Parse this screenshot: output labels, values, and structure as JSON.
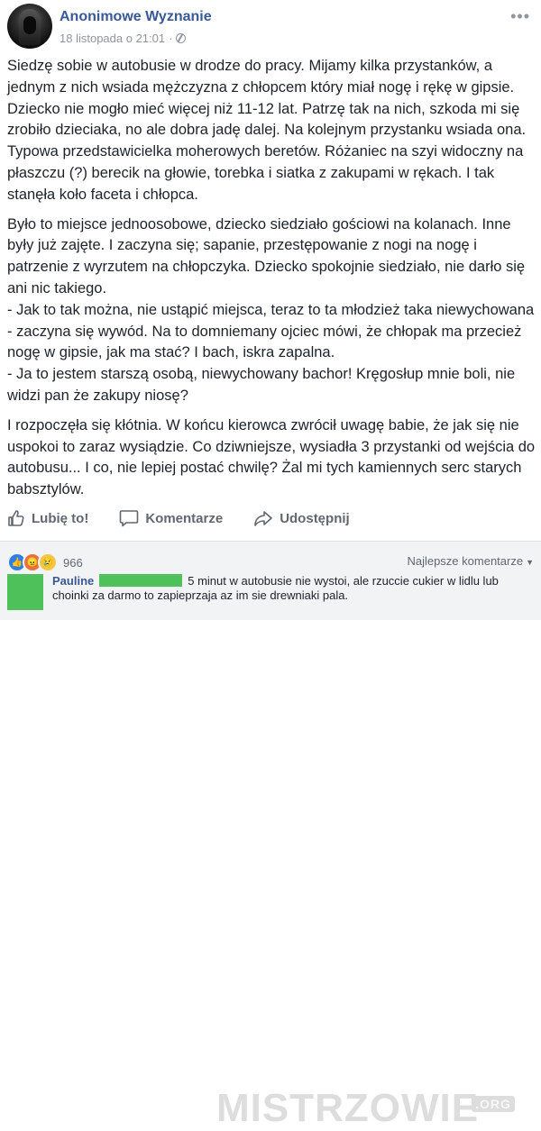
{
  "post": {
    "author": "Anonimowe Wyznanie",
    "date": "18 listopada o 21:01",
    "separator": "·",
    "privacy_icon": "globe-icon",
    "more_icon": "more-icon",
    "paragraphs": [
      "Siedzę sobie w autobusie w drodze do pracy. Mijamy kilka przystanków, a jednym z nich wsiada mężczyzna z chłopcem który miał nogę i rękę w gipsie. Dziecko nie mogło mieć więcej niż 11-12 lat. Patrzę tak na nich, szkoda mi się zrobiło dzieciaka, no ale dobra jadę dalej. Na kolejnym przystanku wsiada ona. Typowa przedstawicielka moherowych beretów. Różaniec na szyi widoczny na płaszczu (?) berecik na głowie, torebka i siatka z zakupami w rękach. I tak stanęła koło faceta i chłopca.",
      "Było to miejsce jednoosobowe, dziecko siedziało gościowi na kolanach. Inne były już zajęte. I zaczyna się; sapanie, przestępowanie z nogi na nogę i patrzenie z wyrzutem na chłopczyka. Dziecko spokojnie siedziało, nie darło się ani nic takiego.\n- Jak to tak można, nie ustąpić miejsca, teraz to ta młodzież taka niewychowana - zaczyna się wywód. Na to domniemany ojciec mówi, że chłopak ma przecież nogę w gipsie, jak ma stać? I bach, iskra zapalna.\n- Ja to jestem starszą osobą, niewychowany bachor! Kręgosłup mnie boli, nie widzi pan że zakupy niosę?",
      "I rozpoczęła się kłótnia. W końcu kierowca zwrócił uwagę babie, że jak się nie uspokoi to zaraz wysiądzie. Co dziwniejsze, wysiadła 3 przystanki od wejścia do autobusu... I co, nie lepiej postać chwilę? Żal mi tych kamiennych serc starych babsztylów."
    ]
  },
  "actions": {
    "like": "Lubię to!",
    "comment": "Komentarze",
    "share": "Udostępnij"
  },
  "reactions": {
    "count": "966",
    "icons": [
      "like-icon",
      "angry-icon",
      "sad-icon"
    ],
    "sort_label": "Najlepsze komentarze"
  },
  "comment": {
    "author": "Pauline",
    "text": "5 minut w autobusie nie wystoi, ale rzuccie cukier w lidlu lub choinki za darmo to zapieprzaja az im sie drewniaki pala."
  },
  "watermark": {
    "text": "MISTRZOWIE",
    "suffix": ".ORG"
  },
  "colors": {
    "link": "#385898",
    "meta": "#90949c",
    "censor": "#4ec15a"
  }
}
